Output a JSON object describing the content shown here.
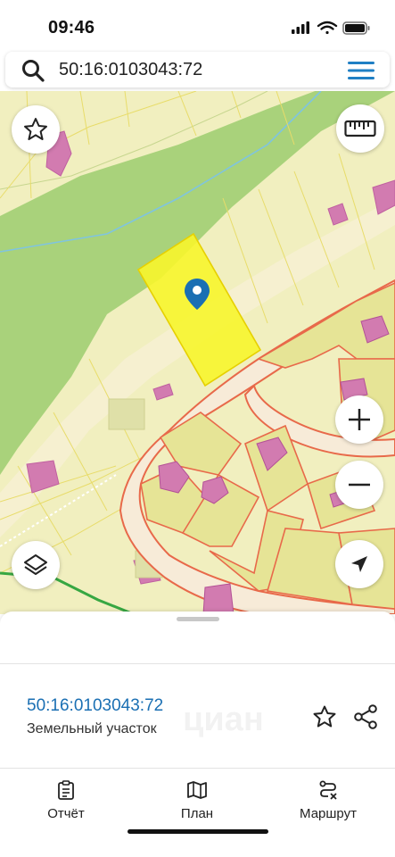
{
  "status_bar": {
    "time": "09:46"
  },
  "search": {
    "query": "50:16:0103043:72"
  },
  "map": {
    "buttons": [
      "star-icon",
      "ruler-icon",
      "layers-icon",
      "zoom-in-icon",
      "zoom-out-icon",
      "location-arrow-icon"
    ],
    "colors": {
      "background": "#f1efbf",
      "forest": "#a9d27b",
      "selected_parcel": "#f7f52c",
      "building": "#d27bb0",
      "road_border": "#e8694a"
    }
  },
  "info_panel": {
    "cadastral_number": "50:16:0103043:72",
    "object_type": "Земельный участок",
    "watermark": "циан"
  },
  "tabs": [
    {
      "label": "Отчёт",
      "icon": "report-icon"
    },
    {
      "label": "План",
      "icon": "map-plan-icon"
    },
    {
      "label": "Маршрут",
      "icon": "route-icon"
    }
  ],
  "colors": {
    "accent": "#1a6fb3",
    "menu": "#1f7fc4"
  }
}
